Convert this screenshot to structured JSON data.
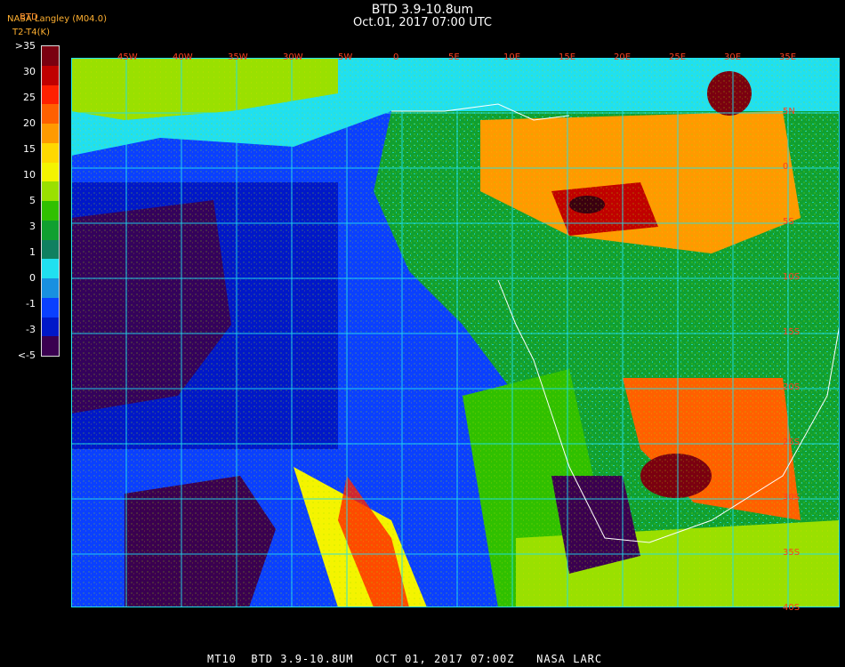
{
  "header": {
    "title": "BTD 3.9-10.8um",
    "datetime": "Oct.01, 2017 07:00 UTC",
    "credit_line1": "NASA Langley (M04.0)",
    "credit_line2": "BTD",
    "credit_line3": "T2-T4(K)"
  },
  "legend": {
    "labels": [
      ">35",
      "30",
      "25",
      "20",
      "15",
      "10",
      "5",
      "3",
      "1",
      "0",
      "-1",
      "-3",
      "<-5"
    ],
    "colors": [
      "#7a0010",
      "#c00000",
      "#ff2000",
      "#ff6000",
      "#ff9a00",
      "#ffd800",
      "#f4f400",
      "#9ae000",
      "#30c000",
      "#10a030",
      "#108060",
      "#20e0f0",
      "#1890e0",
      "#0a40ff",
      "#0018c8",
      "#3a0050"
    ]
  },
  "lon_ticks": [
    "45W",
    "40W",
    "35W",
    "30W",
    "5W",
    "0",
    "5E",
    "10E",
    "15E",
    "20E",
    "25E",
    "30E",
    "35E"
  ],
  "lat_ticks": [
    "5N",
    "0",
    "5S",
    "10S",
    "15S",
    "20S",
    "25S",
    "30S",
    "35S",
    "40S"
  ],
  "footer": "MT10  BTD 3.9-10.8UM   OCT 01, 2017 07:00Z   NASA LARC"
}
